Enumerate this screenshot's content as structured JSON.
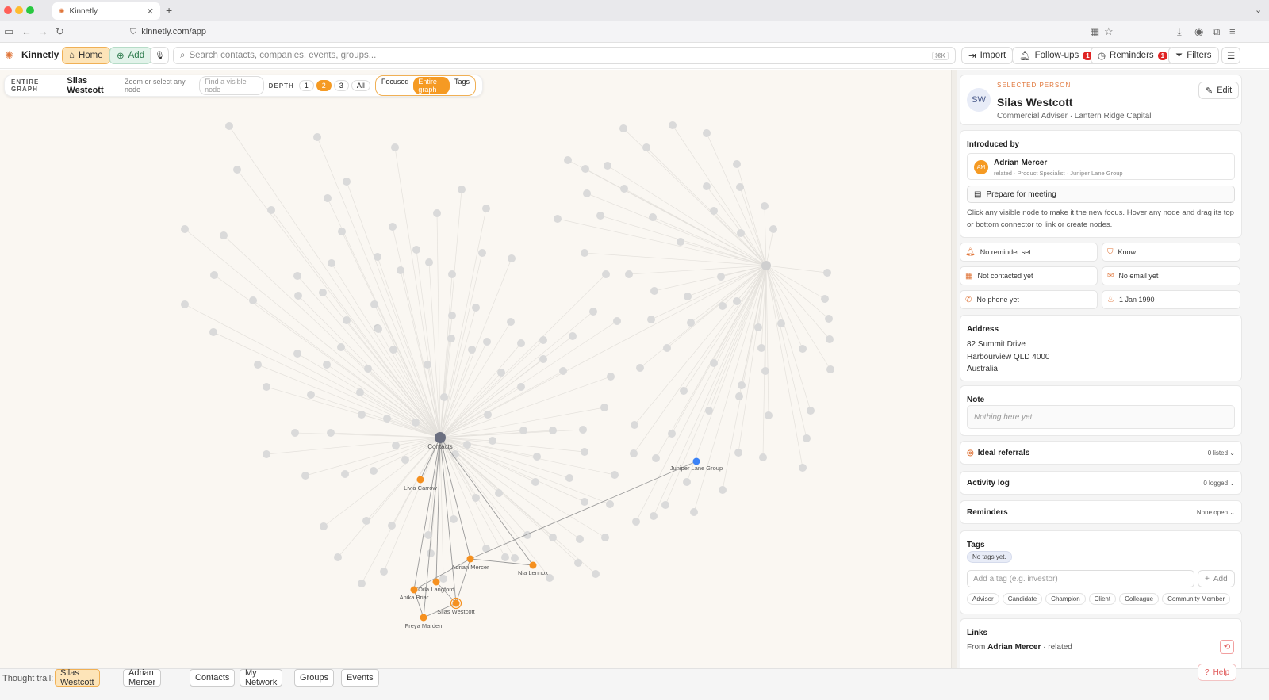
{
  "browser": {
    "tab_title": "Kinnetly",
    "url": "kinnetly.com/app"
  },
  "app": {
    "name": "Kinnetly",
    "home": "Home",
    "add": "Add",
    "search_placeholder": "Search contacts, companies, events, groups...",
    "search_shortcut": "⌘K",
    "import": "Import",
    "followups": "Follow-ups",
    "followups_count": "1",
    "reminders": "Reminders",
    "reminders_count": "1",
    "filters": "Filters"
  },
  "graph_controls": {
    "scope_caption": "ENTIRE GRAPH",
    "focus_name": "Silas Westcott",
    "hint": "Zoom or select any node",
    "find_placeholder": "Find a visible node",
    "depth_caption": "DEPTH",
    "depth_options": [
      "1",
      "2",
      "3",
      "All"
    ],
    "depth_selected": "2",
    "view_options": [
      "Focused",
      "Entire graph",
      "Tags"
    ],
    "view_selected": "Entire graph"
  },
  "graph": {
    "hub_label": "Contacts",
    "nodes": [
      {
        "label": "Livia Carrow"
      },
      {
        "label": "Juniper Lane Group"
      },
      {
        "label": "Adrian Mercer"
      },
      {
        "label": "Nia Lennox"
      },
      {
        "label": "Orla Langford"
      },
      {
        "label": "Anika Briar"
      },
      {
        "label": "Silas Westcott"
      },
      {
        "label": "Freya Marden"
      }
    ],
    "colors": {
      "person": "#f5901f",
      "company": "#3b82f6",
      "hub": "#6b6f80",
      "muted": "#dadada"
    }
  },
  "person": {
    "caption": "SELECTED PERSON",
    "initials": "SW",
    "name": "Silas Westcott",
    "role": "Commercial Adviser · Lantern Ridge Capital",
    "edit": "Edit",
    "introduced_by_label": "Introduced by",
    "introducer": {
      "initials": "AM",
      "name": "Adrian Mercer",
      "meta": "related · Product Specialist · Juniper Lane Group"
    },
    "prepare": "Prepare for meeting",
    "help_text": "Click any visible node to make it the new focus. Hover any node and drag its top or bottom connector to link or create nodes.",
    "facts": [
      "No reminder set",
      "Know",
      "Not contacted yet",
      "No email yet",
      "No phone yet",
      "1 Jan 1990"
    ],
    "address_label": "Address",
    "address": [
      "82 Summit Drive",
      "Harbourview QLD 4000",
      "Australia"
    ],
    "note_label": "Note",
    "note_placeholder": "Nothing here yet.",
    "ideal_referrals": "Ideal referrals",
    "ideal_referrals_count": "0 listed",
    "activity_log": "Activity log",
    "activity_log_count": "0 logged",
    "reminders_label": "Reminders",
    "reminders_status": "None open",
    "tags_label": "Tags",
    "tags_empty": "No tags yet.",
    "tag_placeholder": "Add a tag (e.g. investor)",
    "tag_add": "Add",
    "tag_suggestions": [
      "Advisor",
      "Candidate",
      "Champion",
      "Client",
      "Colleague",
      "Community Member"
    ],
    "links_label": "Links",
    "links_from": "From",
    "links_name": "Adrian Mercer",
    "links_rel": "related"
  },
  "trail": {
    "label": "Thought trail:",
    "items": [
      "Silas Westcott",
      "Adrian Mercer",
      "Contacts",
      "My Network",
      "Groups",
      "Events"
    ]
  },
  "help": "Help"
}
